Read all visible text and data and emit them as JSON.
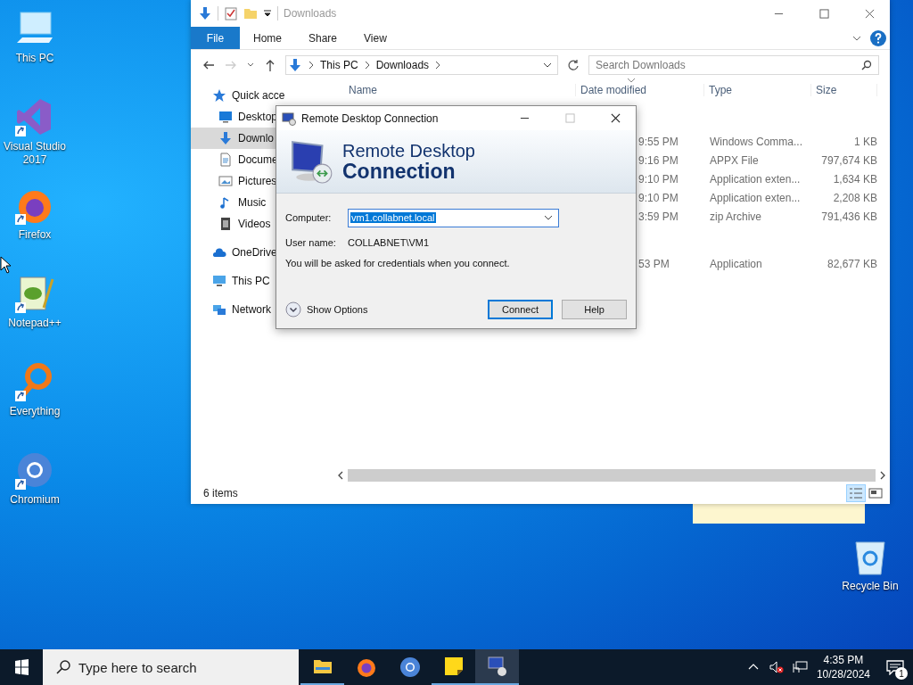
{
  "desktop_icons": [
    {
      "label": "This PC",
      "kind": "pc",
      "shortcut": false
    },
    {
      "label": "Visual Studio 2017",
      "kind": "vs",
      "shortcut": true
    },
    {
      "label": "Firefox",
      "kind": "firefox",
      "shortcut": true
    },
    {
      "label": "Notepad++",
      "kind": "notepad",
      "shortcut": true
    },
    {
      "label": "Everything",
      "kind": "everything",
      "shortcut": true
    },
    {
      "label": "Chromium",
      "kind": "chromium",
      "shortcut": true
    }
  ],
  "recycle_bin": {
    "label": "Recycle Bin"
  },
  "explorer": {
    "title": "Downloads",
    "file_tab": "File",
    "ribbon_tabs": [
      "Home",
      "Share",
      "View"
    ],
    "path": [
      "This PC",
      "Downloads"
    ],
    "search": {
      "placeholder": "Search Downloads"
    },
    "columns": [
      "Name",
      "Date modified",
      "Type",
      "Size"
    ],
    "nav": [
      {
        "label": "Quick acce",
        "kind": "star",
        "selected": false,
        "children": [
          {
            "label": "Desktop",
            "kind": "desktop",
            "selected": false
          },
          {
            "label": "Downlo",
            "kind": "download",
            "selected": true
          },
          {
            "label": "Docume",
            "kind": "document",
            "selected": false
          },
          {
            "label": "Pictures",
            "kind": "pictures",
            "selected": false
          },
          {
            "label": "Music",
            "kind": "music",
            "selected": false
          },
          {
            "label": "Videos",
            "kind": "videos",
            "selected": false
          }
        ]
      },
      {
        "label": "OneDrive",
        "kind": "cloud",
        "selected": false
      },
      {
        "label": "This PC",
        "kind": "pc",
        "selected": false
      },
      {
        "label": "Network",
        "kind": "network",
        "selected": false
      }
    ],
    "groups": [
      {
        "rows": [
          {
            "date": "9:55 PM",
            "type": "Windows Comma...",
            "size": "1 KB"
          },
          {
            "date": "9:16 PM",
            "type": "APPX File",
            "size": "797,674 KB"
          },
          {
            "date": "9:10 PM",
            "type": "Application exten...",
            "size": "1,634 KB"
          },
          {
            "date": "9:10 PM",
            "type": "Application exten...",
            "size": "2,208 KB"
          },
          {
            "date": "3:59 PM",
            "type": "zip Archive",
            "size": "791,436 KB"
          }
        ]
      },
      {
        "rows": [
          {
            "date": "53 PM",
            "type": "Application",
            "size": "82,677 KB"
          }
        ]
      }
    ],
    "status": "6 items"
  },
  "rdc": {
    "title": "Remote Desktop Connection",
    "banner_line_1": "Remote Desktop",
    "banner_line_2": "Connection",
    "computer_label": "Computer:",
    "computer_value": "vm1.collabnet.local",
    "user_label": "User name:",
    "user_value": "COLLABNET\\VM1",
    "note": "You will be asked for credentials when you connect.",
    "show_options": "Show Options",
    "buttons": [
      {
        "label": "Connect",
        "default": true
      },
      {
        "label": "Help",
        "default": false
      }
    ]
  },
  "taskbar": {
    "search_placeholder": "Type here to search",
    "apps": [
      {
        "kind": "explorer",
        "running": true,
        "active": false
      },
      {
        "kind": "firefox",
        "running": false,
        "active": false
      },
      {
        "kind": "chromium",
        "running": false,
        "active": false
      },
      {
        "kind": "sticky",
        "running": true,
        "active": false
      },
      {
        "kind": "rdc",
        "running": true,
        "active": true
      }
    ],
    "time": "4:35 PM",
    "date": "10/28/2024",
    "notifications": "1"
  }
}
